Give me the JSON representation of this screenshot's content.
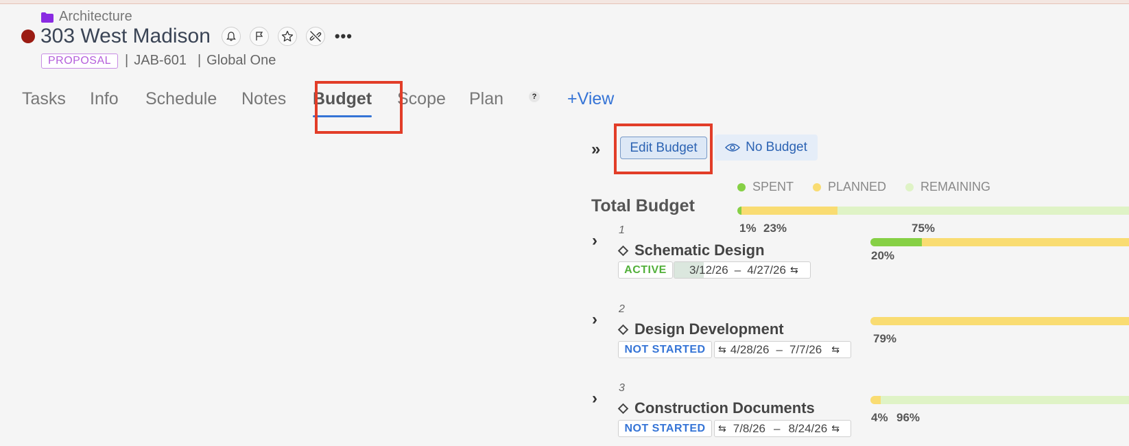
{
  "project": {
    "folder": "Architecture",
    "title": "303 West Madison",
    "status_badge": "PROPOSAL",
    "code": "JAB-601",
    "client": "Global One",
    "separator": "|"
  },
  "tabs": [
    {
      "label": "Tasks"
    },
    {
      "label": "Info"
    },
    {
      "label": "Schedule"
    },
    {
      "label": "Notes"
    },
    {
      "label": "Budget",
      "active": true
    },
    {
      "label": "Scope"
    },
    {
      "label": "Plan",
      "help": "?"
    },
    {
      "label": "+View"
    }
  ],
  "toolbar": {
    "collapse_glyph": "»",
    "edit_budget": "Edit Budget",
    "no_budget": "No Budget"
  },
  "legend": [
    {
      "label": "SPENT",
      "color": "#86d045"
    },
    {
      "label": "PLANNED",
      "color": "#f9dc72"
    },
    {
      "label": "REMAINING",
      "color": "#dff3c6"
    }
  ],
  "total": {
    "label": "Total Budget",
    "spent_label": "1%",
    "planned_label": "23%",
    "remaining_label": "75%",
    "spent": 0.01,
    "planned": 0.23,
    "remaining": 0.75
  },
  "phases": [
    {
      "number": "1",
      "name": "Schematic Design",
      "status": "ACTIVE",
      "start": "3/12/26",
      "dash": "–",
      "end": "4/27/26",
      "progress": "20%",
      "spent": 0.2,
      "planned": 0.8,
      "remaining": 0
    },
    {
      "number": "2",
      "name": "Design Development",
      "status": "NOT STARTED",
      "start": "4/28/26",
      "dash": "–",
      "end": "7/7/26",
      "progress": "79%",
      "spent": 0,
      "planned": 1.0,
      "remaining": 0
    },
    {
      "number": "3",
      "name": "Construction Documents",
      "status": "NOT STARTED",
      "start": "7/8/26",
      "dash": "–",
      "end": "8/24/26",
      "progress_planned": "4%",
      "progress_remaining": "96%",
      "spent": 0,
      "planned": 0.04,
      "remaining": 0.96
    }
  ]
}
